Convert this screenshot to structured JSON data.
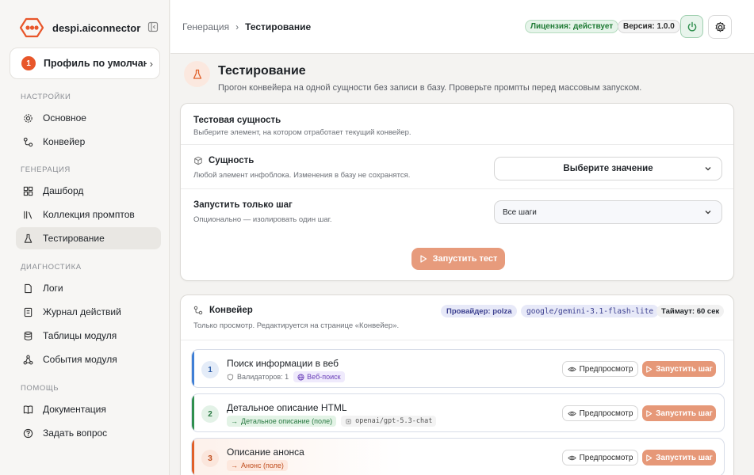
{
  "app": {
    "name": "despi.aiconnector"
  },
  "profile": {
    "badge": "1",
    "name": "Профиль по умолчан..."
  },
  "sidebar": {
    "sections": [
      {
        "label": "Настройки",
        "items": [
          {
            "label": "Основное",
            "icon": "gear-icon"
          },
          {
            "label": "Конвейер",
            "icon": "workflow-icon"
          }
        ]
      },
      {
        "label": "Генерация",
        "items": [
          {
            "label": "Дашборд",
            "icon": "dashboard-icon"
          },
          {
            "label": "Коллекция промптов",
            "icon": "library-icon"
          },
          {
            "label": "Тестирование",
            "icon": "flask-icon",
            "active": true
          }
        ]
      },
      {
        "label": "Диагностика",
        "items": [
          {
            "label": "Логи",
            "icon": "file-icon"
          },
          {
            "label": "Журнал действий",
            "icon": "journal-icon"
          },
          {
            "label": "Таблицы модуля",
            "icon": "database-icon"
          },
          {
            "label": "События модуля",
            "icon": "events-icon"
          }
        ]
      },
      {
        "label": "Помощь",
        "items": [
          {
            "label": "Документация",
            "icon": "book-icon"
          },
          {
            "label": "Задать вопрос",
            "icon": "help-icon"
          }
        ]
      }
    ]
  },
  "topbar": {
    "breadcrumb": [
      "Генерация",
      "Тестирование"
    ],
    "license": "Лицензия: действует",
    "version": "Версия: 1.0.0"
  },
  "page": {
    "title": "Тестирование",
    "subtitle": "Прогон конвейера на одной сущности без записи в базу. Проверьте промпты перед массовым запуском."
  },
  "test_card": {
    "title": "Тестовая сущность",
    "desc": "Выберите элемент, на котором отработает текущий конвейер.",
    "entity": {
      "label": "Сущность",
      "desc": "Любой элемент инфоблока. Изменения в базу не сохранятся.",
      "value": "Выберите значение"
    },
    "step": {
      "label": "Запустить только шаг",
      "desc": "Опционально — изолировать один шаг.",
      "value": "Все шаги"
    },
    "run_label": "Запустить тест"
  },
  "pipeline_card": {
    "title": "Конвейер",
    "desc": "Только просмотр. Редактируется на странице «Конвейер».",
    "provider": "Провайдер: polza",
    "model": "google/gemini-3.1-flash-lite",
    "timeout": "Таймаут: 60 сек",
    "preview_label": "Предпросмотр",
    "run_step_label": "Запустить шаг",
    "steps": [
      {
        "num": "1",
        "title": "Поиск информации в веб",
        "validators": "Валидаторов: 1",
        "chip": "Веб-поиск",
        "model": "",
        "accent": "#3f7fd6",
        "num_bg": "#e4ecf8",
        "num_color": "#2f5fa8",
        "chip_bg": "#efeafc",
        "chip_color": "#6a3fb8"
      },
      {
        "num": "2",
        "title": "Детальное описание HTML",
        "validators": "",
        "chip": "Детальное описание (поле)",
        "model": "openai/gpt-5.3-chat",
        "accent": "#2f8f4e",
        "num_bg": "#e3f2e7",
        "num_color": "#2a7a43",
        "chip_bg": "#e3f3e6",
        "chip_color": "#2a7a43"
      },
      {
        "num": "3",
        "title": "Описание анонса",
        "validators": "",
        "chip": "Анонс (поле)",
        "model": "",
        "accent": "#e0602a",
        "num_bg": "#fbe6dc",
        "num_color": "#c04e1e",
        "chip_bg": "#fde8de",
        "chip_color": "#c04e1e"
      }
    ]
  }
}
